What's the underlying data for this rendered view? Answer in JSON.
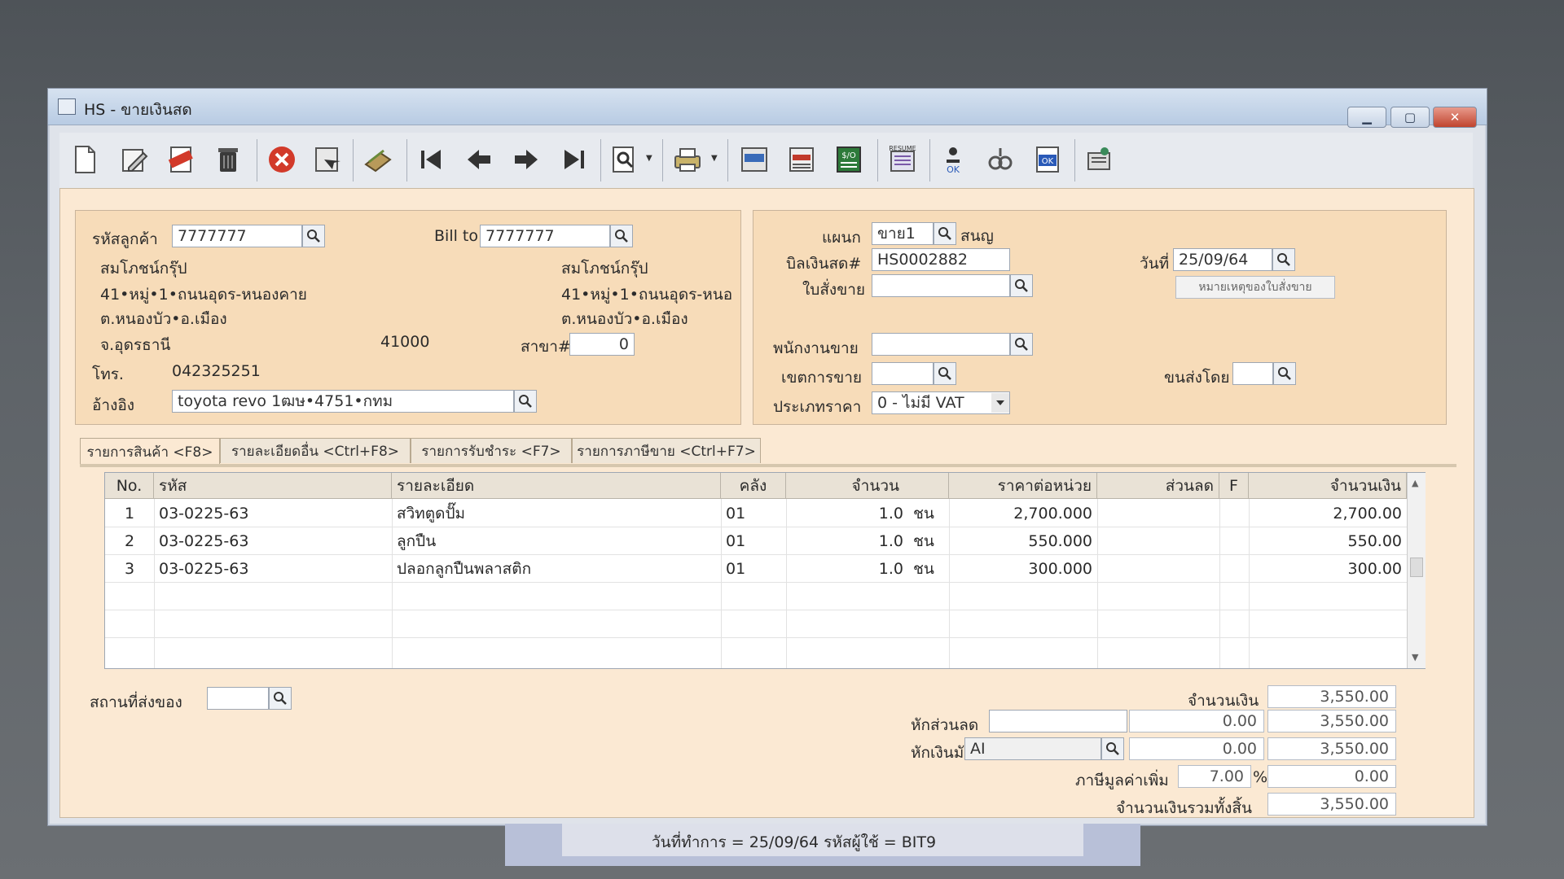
{
  "window": {
    "title": "HS - ขายเงินสด"
  },
  "toolbar": {
    "icons": [
      "new-doc-icon",
      "edit-icon",
      "void-icon",
      "trash-icon",
      "cancel-icon",
      "save-icon",
      "attach-icon",
      "first-record-icon",
      "prev-record-icon",
      "next-record-icon",
      "last-record-icon",
      "search-doc-icon",
      "print-icon",
      "note-icon",
      "list-icon",
      "sale-order-icon",
      "resume-icon",
      "approve-icon",
      "link-icon",
      "ok-icon",
      "screen-icon"
    ]
  },
  "customer": {
    "code_label": "รหัสลูกค้า",
    "code": "7777777",
    "name": "สมโภชน์กรุ๊ป",
    "addr1": "41•หมู่•1•ถนนอุดร-หนองคาย",
    "addr2": "ต.หนองบัว•อ.เมือง",
    "province": "จ.อุดรธานี",
    "zip": "41000",
    "phone_label": "โทร.",
    "phone": "042325251",
    "ref_label": "อ้างอิง",
    "ref": "toyota revo 1ฒษ•4751•กทม"
  },
  "bill_to": {
    "label": "Bill to",
    "code": "7777777",
    "name": "สมโภชน์กรุ๊ป",
    "addr1": "41•หมู่•1•ถนนอุดร-หนอ",
    "addr2": "ต.หนองบัว•อ.เมือง",
    "branch_label": "สาขา#",
    "branch": "0"
  },
  "doc": {
    "dept_label": "แผนก",
    "dept": "ขาย1",
    "dept_name": "สนญ",
    "bill_label": "บิลเงินสด#",
    "bill_no": "HS0002882",
    "date_label": "วันที่",
    "date": "25/09/64",
    "so_label": "ใบสั่งขาย",
    "so": "",
    "so_note_button": "หมายเหตุของใบสั่งขาย",
    "salesman_label": "พนักงานขาย",
    "salesman": "",
    "area_label": "เขตการขาย",
    "area": "",
    "shipby_label": "ขนส่งโดย",
    "shipby": "",
    "pricetype_label": "ประเภทราคา",
    "pricetype": "0 - ไม่มี VAT"
  },
  "tabs": [
    "รายการสินค้า <F8>",
    "รายละเอียดอื่น <Ctrl+F8>",
    "รายการรับชำระ <F7>",
    "รายการภาษีขาย <Ctrl+F7>"
  ],
  "grid": {
    "headers": {
      "no": "No.",
      "code": "รหัส",
      "desc": "รายละเอียด",
      "wh": "คลัง",
      "qty": "จำนวน",
      "price": "ราคาต่อหน่วย",
      "disc": "ส่วนลด",
      "f": "F",
      "amount": "จำนวนเงิน"
    },
    "rows": [
      {
        "no": "1",
        "code": "03-0225-63",
        "desc": "สวิทตูดปั๊ม",
        "wh": "01",
        "qty": "1.0",
        "unit": "ชน",
        "price": "2,700.000",
        "disc": "",
        "amount": "2,700.00"
      },
      {
        "no": "2",
        "code": "03-0225-63",
        "desc": "ลูกปืน",
        "wh": "01",
        "qty": "1.0",
        "unit": "ชน",
        "price": "550.000",
        "disc": "",
        "amount": "550.00"
      },
      {
        "no": "3",
        "code": "03-0225-63",
        "desc": "ปลอกลูกปืนพลาสติก",
        "wh": "01",
        "qty": "1.0",
        "unit": "ชน",
        "price": "300.000",
        "disc": "",
        "amount": "300.00"
      }
    ]
  },
  "footer": {
    "ship_place_label": "สถานที่ส่งของ",
    "ship_place": "",
    "amount_label": "จำนวนเงิน",
    "amount": "3,550.00",
    "discount_label": "หักส่วนลด",
    "discount_text": "",
    "discount_value": "0.00",
    "after_discount": "3,550.00",
    "deposit_label": "หักเงินมัดจำ",
    "deposit_code": "AI",
    "deposit_value": "0.00",
    "after_deposit": "3,550.00",
    "vat_label": "ภาษีมูลค่าเพิ่ม",
    "vat_rate": "7.00",
    "vat_pct": "%",
    "vat_amount": "0.00",
    "grand_label": "จำนวนเงินรวมทั้งสิ้น",
    "grand_total": "3,550.00"
  },
  "status": {
    "text": "วันที่ทำการ  =  25/09/64     รหัสผู้ใช้  =  BIT9"
  },
  "colors": {
    "panel": "#f7dcb9",
    "titlebar": "#b8cbe3",
    "cancel": "#d23a2a"
  }
}
